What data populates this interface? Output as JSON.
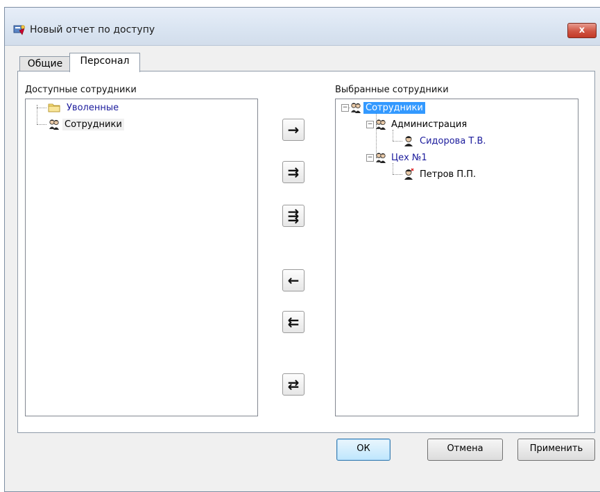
{
  "window": {
    "title": "Новый отчет по доступу",
    "close_glyph": "x"
  },
  "tabs": [
    {
      "label": "Общие",
      "active": false
    },
    {
      "label": "Персонал",
      "active": true
    }
  ],
  "available": {
    "label": "Доступные сотрудники",
    "nodes": [
      {
        "label": "Уволенные",
        "icon": "folder-icon"
      },
      {
        "label": "Сотрудники",
        "icon": "people-group-icon"
      }
    ]
  },
  "selected": {
    "label": "Выбранные сотрудники",
    "root": {
      "label": "Сотрудники",
      "icon": "people-group-icon",
      "expander": "−"
    },
    "children": [
      {
        "label": "Администрация",
        "icon": "people-group-icon",
        "expander": "−"
      },
      {
        "label": "Сидорова Т.В.",
        "icon": "person-icon"
      },
      {
        "label": "Цех №1",
        "icon": "people-group-icon",
        "expander": "−"
      },
      {
        "label": "Петров П.П.",
        "icon": "person-icon"
      }
    ]
  },
  "move_buttons": [
    {
      "name": "move-right-button",
      "glyph": "→",
      "icon": "arrow-right-icon"
    },
    {
      "name": "move-all-right-button",
      "glyph": "⇉",
      "icon": "double-arrow-right-icon"
    },
    {
      "name": "move-group-right-button",
      "glyph": "⇶",
      "icon": "dotted-double-arrow-right-icon"
    },
    {
      "name": "move-left-button",
      "glyph": "←",
      "icon": "arrow-left-icon"
    },
    {
      "name": "move-all-left-button",
      "glyph": "⇇",
      "icon": "double-arrow-left-icon"
    },
    {
      "name": "swap-button",
      "glyph": "⇄",
      "icon": "swap-arrows-icon"
    }
  ],
  "footer": {
    "ok": "ОК",
    "cancel": "Отмена",
    "apply": "Применить"
  }
}
